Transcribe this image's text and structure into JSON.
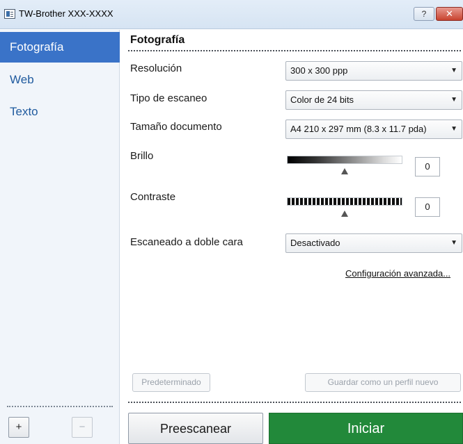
{
  "window": {
    "title": "TW-Brother  XXX-XXXX",
    "help_label": "?",
    "close_label": "✕"
  },
  "sidebar": {
    "items": [
      {
        "label": "Fotografía",
        "active": true
      },
      {
        "label": "Web",
        "active": false
      },
      {
        "label": "Texto",
        "active": false
      }
    ],
    "add_label": "+",
    "remove_label": "−"
  },
  "main": {
    "section_title": "Fotografía",
    "resolution": {
      "label": "Resolución",
      "value": "300 x 300 ppp"
    },
    "scan_type": {
      "label": "Tipo de escaneo",
      "value": "Color de 24 bits"
    },
    "doc_size": {
      "label": "Tamaño documento",
      "value": "A4 210 x 297 mm (8.3 x 11.7 pda)"
    },
    "brightness": {
      "label": "Brillo",
      "value": "0",
      "level": 0.5
    },
    "contrast": {
      "label": "Contraste",
      "value": "0",
      "level": 0.5
    },
    "duplex": {
      "label": "Escaneado a doble cara",
      "value": "Desactivado"
    },
    "advanced_link": "Configuración avanzada...",
    "default_button": "Predeterminado",
    "save_profile_button": "Guardar como un perfil nuevo",
    "preview_button": "Preescanear",
    "start_button": "Iniciar"
  },
  "colors": {
    "accent": "#3a73c8",
    "start": "#22893a"
  },
  "icons": {
    "dropdown": "triangle-down-icon",
    "app": "window-icon"
  }
}
